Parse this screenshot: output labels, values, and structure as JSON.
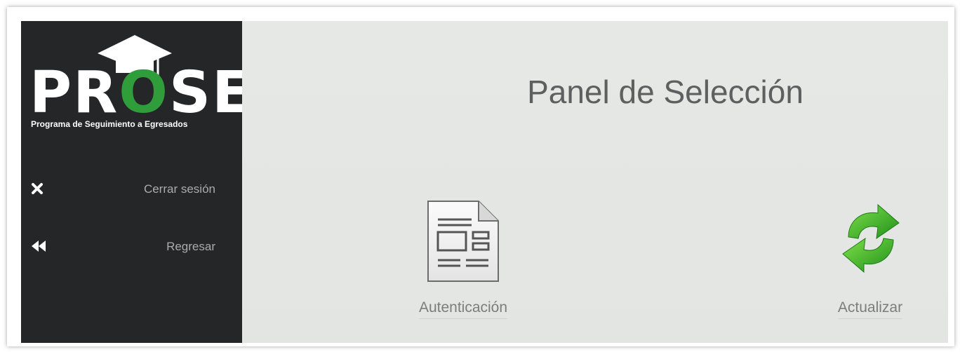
{
  "logo": {
    "letters_left": "PR",
    "letter_o": "O",
    "letters_right": "SE",
    "subtitle": "Programa de Seguimiento a Egresados"
  },
  "sidebar": {
    "items": [
      {
        "label": "Cerrar sesión",
        "icon": "close-icon"
      },
      {
        "label": "Regresar",
        "icon": "fast-backward-icon"
      }
    ]
  },
  "main": {
    "title": "Panel de Selección",
    "tiles": [
      {
        "label": "Autenticación",
        "icon": "document-icon"
      },
      {
        "label": "Actualizar",
        "icon": "refresh-icon"
      }
    ]
  },
  "colors": {
    "sidebar_bg": "#242628",
    "main_bg": "#e5e7e5",
    "logo_green": "#2e9d3a",
    "refresh_green": "#3fbf2a"
  }
}
